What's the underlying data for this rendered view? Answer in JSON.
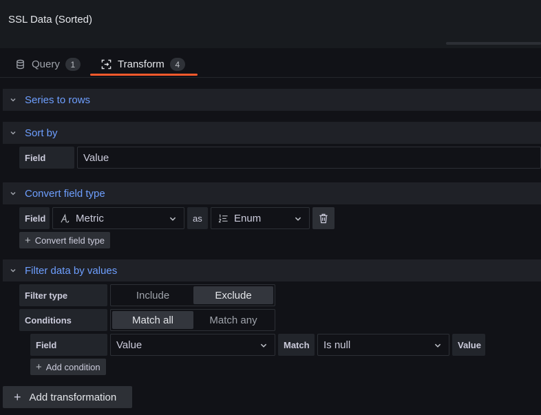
{
  "panel": {
    "title": "SSL Data (Sorted)"
  },
  "tabs": [
    {
      "label": "Query",
      "count": "1"
    },
    {
      "label": "Transform",
      "count": "4"
    }
  ],
  "sections": {
    "series_to_rows": {
      "title": "Series to rows"
    },
    "sort_by": {
      "title": "Sort by",
      "field_label": "Field",
      "field_value": "Value"
    },
    "convert_field_type": {
      "title": "Convert field type",
      "field_label": "Field",
      "field_value": "Metric",
      "as_label": "as",
      "type_value": "Enum",
      "add_button": "Convert field type"
    },
    "filter_data_by_values": {
      "title": "Filter data by values",
      "filter_type_label": "Filter type",
      "filter_type_options": [
        "Include",
        "Exclude"
      ],
      "filter_type_selected": "Exclude",
      "conditions_label": "Conditions",
      "conditions_options": [
        "Match all",
        "Match any"
      ],
      "conditions_selected": "Match all",
      "condition": {
        "field_label": "Field",
        "field_value": "Value",
        "match_label": "Match",
        "match_value": "Is null",
        "value_label": "Value"
      },
      "add_condition_button": "Add condition"
    }
  },
  "footer": {
    "add_transformation_button": "Add transformation"
  },
  "colors": {
    "accent": "#6e9fff",
    "tab_underline": "#ff5a2c",
    "background": "#111217"
  }
}
